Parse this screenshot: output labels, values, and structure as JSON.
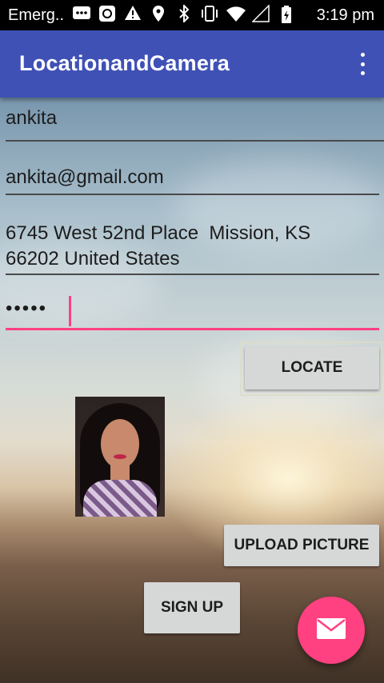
{
  "status_bar": {
    "carrier": "Emerg..",
    "time": "3:19 pm"
  },
  "app_bar": {
    "title": "LocationandCamera"
  },
  "form": {
    "name_value": "ankita",
    "email_value": "ankita@gmail.com",
    "address_line1": "6745 West 52nd Place  Mission, KS",
    "address_line2": "66202 United States",
    "password_value": "•••••"
  },
  "buttons": {
    "locate": "LOCATE",
    "upload_picture": "UPLOAD PICTURE",
    "sign_up": "SIGN UP"
  },
  "fab": {
    "icon": "email-icon",
    "color": "#ff4081"
  },
  "colors": {
    "app_bar": "#3f51b5",
    "accent": "#ff4081",
    "button": "#d6d7d7"
  }
}
